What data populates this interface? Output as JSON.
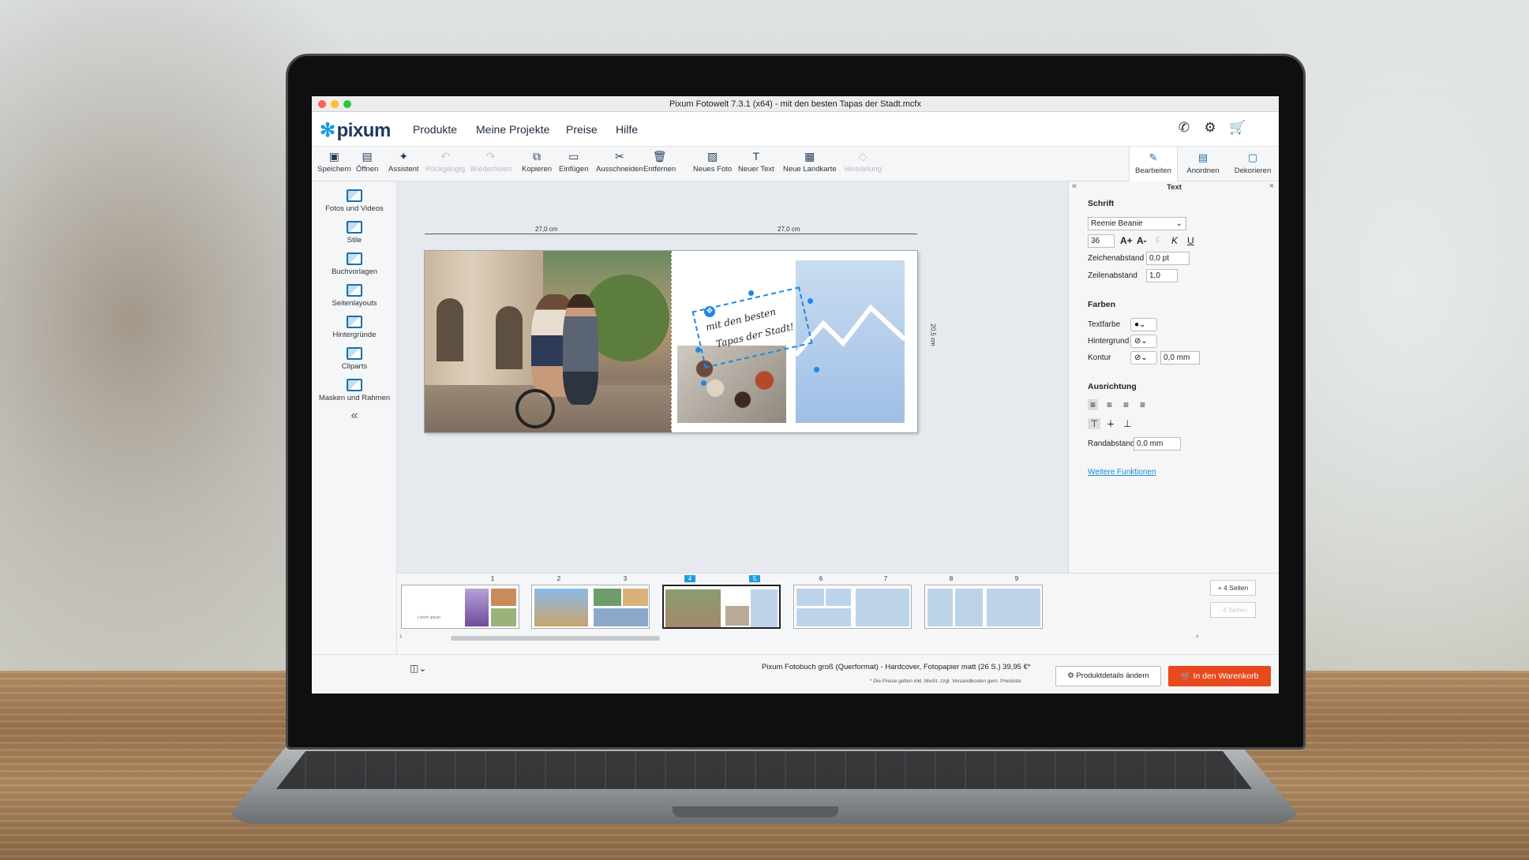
{
  "window": {
    "title": "Pixum Fotowelt 7.3.1 (x64) -  mit den besten    Tapas der Stadt.mcfx"
  },
  "menu": {
    "logo": "pixum",
    "items": [
      "Produkte",
      "Meine Projekte",
      "Preise",
      "Hilfe"
    ]
  },
  "toolbar": {
    "buttons": [
      "Speichern",
      "Öffnen",
      "Assistent",
      "Rückgängig",
      "Wiederholen",
      "Kopieren",
      "Einfügen",
      "Ausschneiden",
      "Entfernen",
      "Neues Foto",
      "Neuer Text",
      "Neue Landkarte",
      "Veredelung"
    ],
    "tabs": [
      "Bearbeiten",
      "Anordnen",
      "Dekorieren"
    ]
  },
  "leftpanel": {
    "items": [
      "Fotos und Videos",
      "Stile",
      "Buchvorlagen",
      "Seitenlayouts",
      "Hintergründe",
      "Cliparts",
      "Masken und Rahmen"
    ],
    "collapse": "«"
  },
  "canvas": {
    "dim_left": "27,0 cm",
    "dim_right": "27,0 cm",
    "dim_height": "20,5 cm",
    "text_line1": "mit den besten",
    "text_line2": "Tapas der Stadt!"
  },
  "rightpanel": {
    "title": "Text",
    "schrift": {
      "heading": "Schrift",
      "font": "Reenie Beanie",
      "size": "36",
      "zeichenabstand_label": "Zeichenabstand",
      "zeichenabstand": "0,0 pt",
      "zeilenabstand_label": "Zeilenabstand",
      "zeilenabstand": "1,0"
    },
    "farben": {
      "heading": "Farben",
      "textfarbe": "Textfarbe",
      "hintergrund": "Hintergrund",
      "kontur": "Kontur",
      "kontur_value": "0,0 mm"
    },
    "ausrichtung": {
      "heading": "Ausrichtung",
      "randabstand_label": "Randabstand",
      "randabstand": "0,0 mm"
    },
    "more": "Weitere Funktionen"
  },
  "pages": {
    "numbers": [
      "1",
      "2",
      "3",
      "4",
      "5",
      "6",
      "7",
      "8",
      "9"
    ],
    "add_pages": "+ 4 Seiten",
    "remove_pages": "- 4 Seiten",
    "title_page_text": "Lorem Ipsum"
  },
  "footer": {
    "product": "Pixum Fotobuch groß (Querformat) - Hardcover, Fotopapier matt (26 S.) 39,95 €*",
    "note": "* Die Preise gelten inkl. MwSt. zzgl. Versandkosten gem. Preisliste.",
    "product_button": "Produktdetails ändern",
    "cart_button": "In den Warenkorb"
  },
  "colors": {
    "accent": "#1e9be0",
    "cart": "#e8491d",
    "brand": "#1d3a5c"
  }
}
